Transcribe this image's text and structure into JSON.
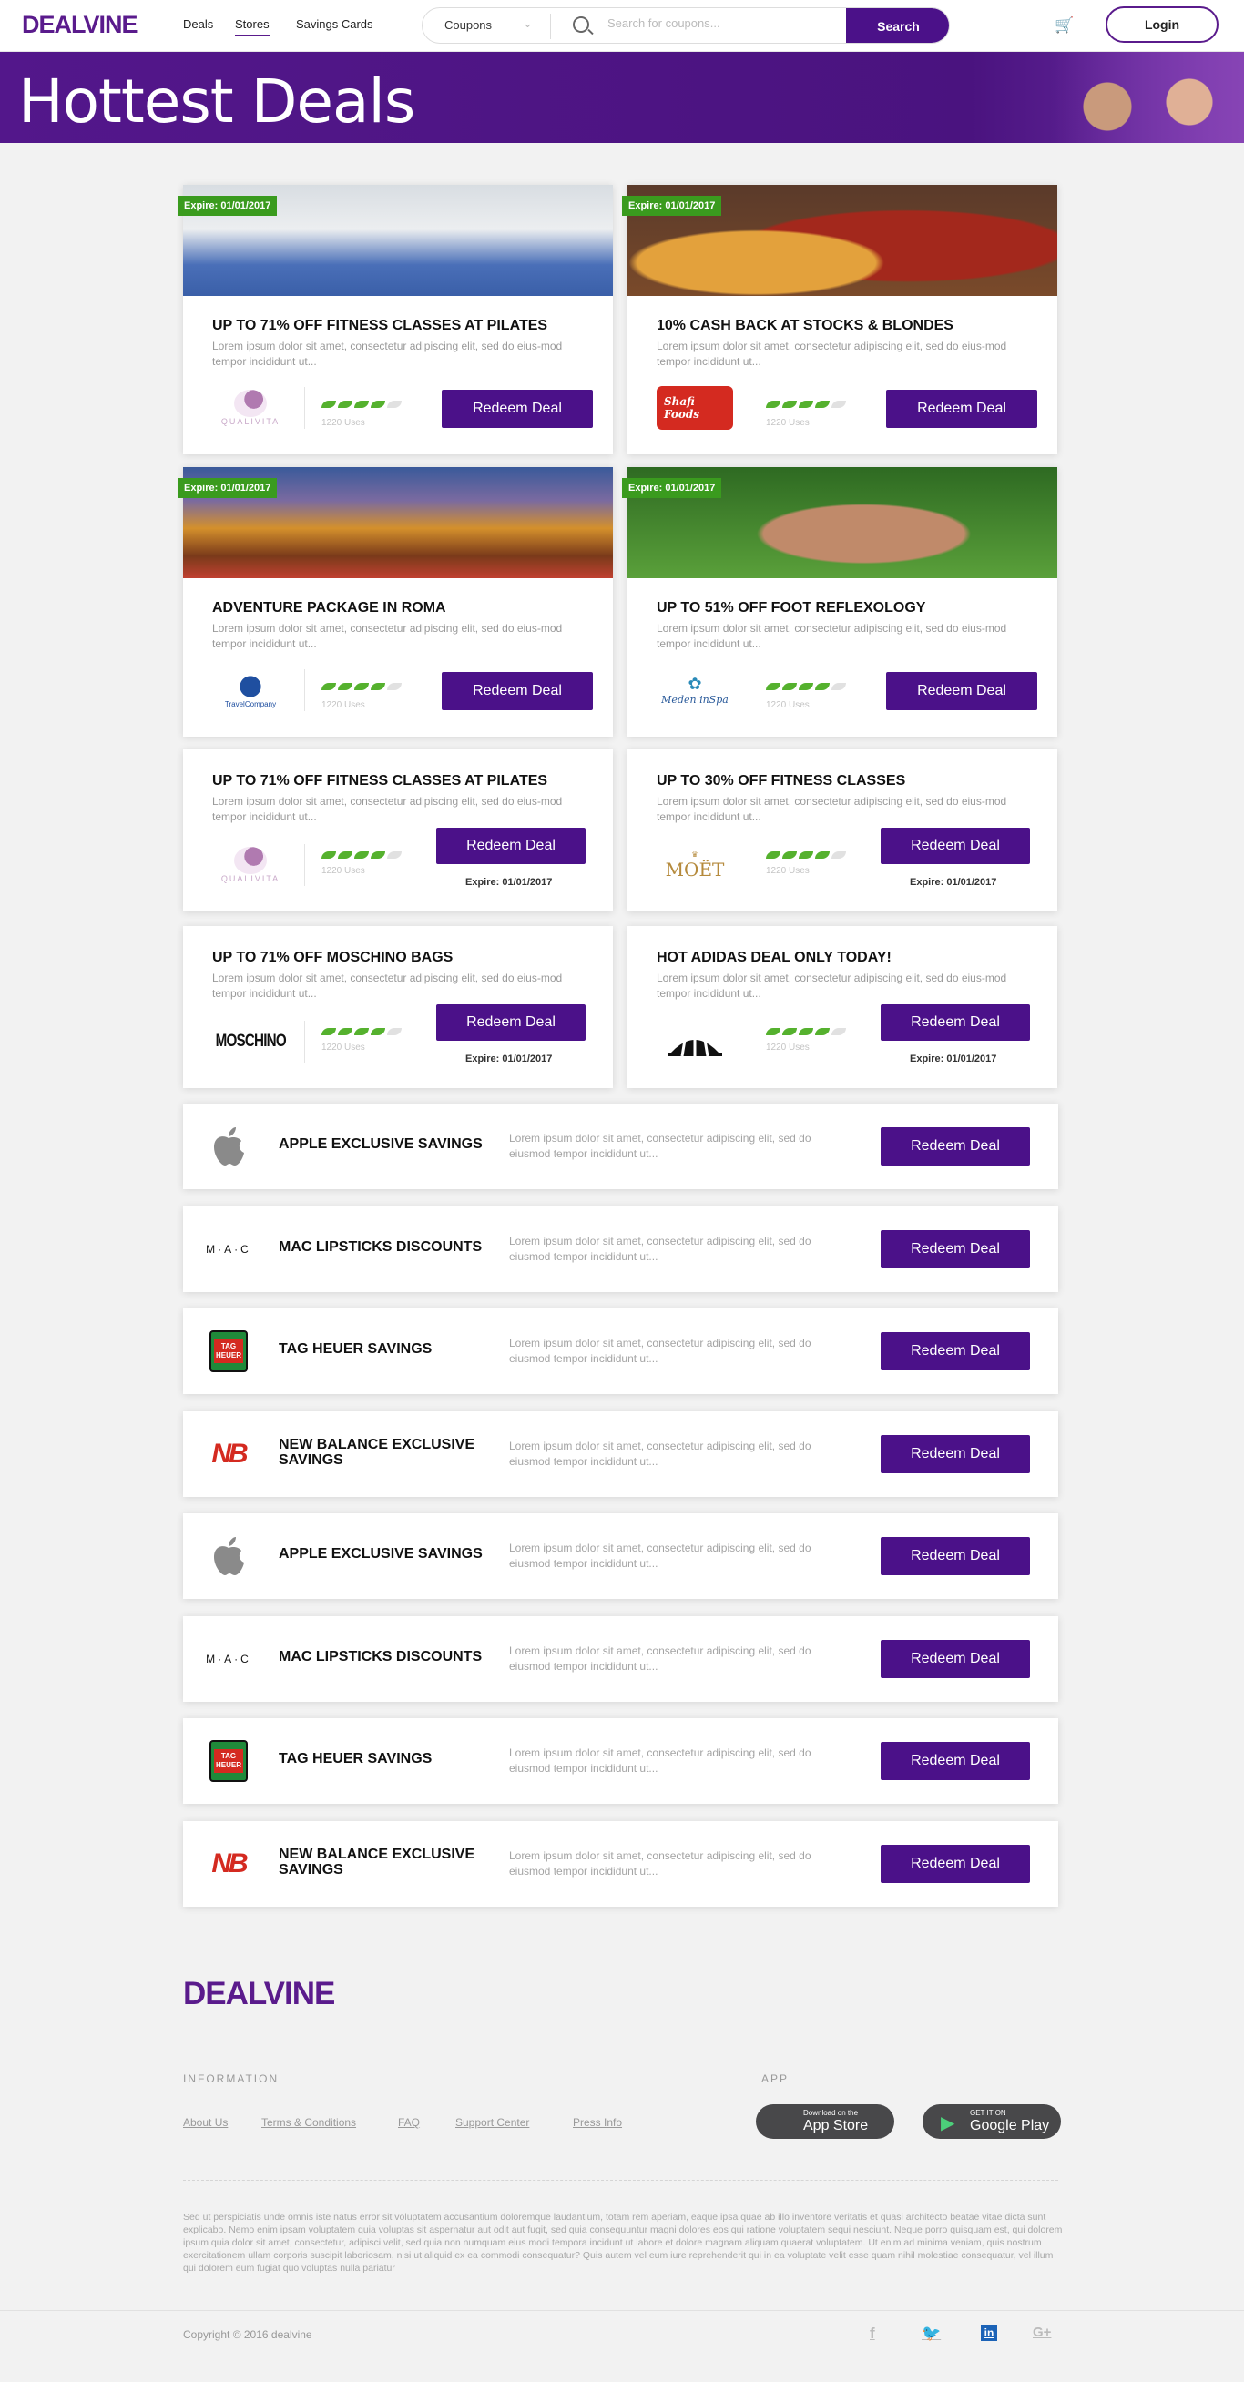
{
  "header": {
    "logo": "DEALVINE",
    "nav": [
      "Deals",
      "Stores",
      "Savings Cards"
    ],
    "active_nav": "Stores",
    "coupon_select": "Coupons",
    "search_placeholder": "Search for coupons...",
    "search_button": "Search",
    "login_button": "Login"
  },
  "banner": {
    "title": "Hottest Deals"
  },
  "image_deals": [
    {
      "expire": "Expire: 01/01/2017",
      "title": "UP TO 71% OFF FITNESS CLASSES AT PILATES",
      "desc": "Lorem ipsum dolor sit amet, consectetur adipiscing elit, sed do eius-mod tempor incididunt ut...",
      "logo": "QUALIVITA",
      "logo_icon": "qualivita-logo",
      "rating": 4,
      "uses": "1220 Uses",
      "button": "Redeem Deal"
    },
    {
      "expire": "Expire: 01/01/2017",
      "title": "10% CASH BACK AT STOCKS & BLONDES",
      "desc": "Lorem ipsum dolor sit amet, consectetur adipiscing elit, sed do eius-mod tempor incididunt ut...",
      "logo": "Shafi Foods",
      "logo_icon": "shafi-foods-logo",
      "rating": 4,
      "uses": "1220 Uses",
      "button": "Redeem Deal"
    },
    {
      "expire": "Expire: 01/01/2017",
      "title": "ADVENTURE PACKAGE IN ROMA",
      "desc": "Lorem ipsum dolor sit amet, consectetur adipiscing elit, sed do eius-mod tempor incididunt ut...",
      "logo": "TravelCompany",
      "logo_icon": "travel-company-logo",
      "rating": 4,
      "uses": "1220 Uses",
      "button": "Redeem Deal"
    },
    {
      "expire": "Expire: 01/01/2017",
      "title": "UP TO 51% OFF FOOT REFLEXOLOGY",
      "desc": "Lorem ipsum dolor sit amet, consectetur adipiscing elit, sed do eius-mod tempor incididunt ut...",
      "logo": "Meden inSpa",
      "logo_icon": "meden-inspa-logo",
      "rating": 4,
      "uses": "1220 Uses",
      "button": "Redeem Deal"
    }
  ],
  "text_deals": [
    {
      "title": "UP TO 71% OFF FITNESS CLASSES AT PILATES",
      "desc": "Lorem ipsum dolor sit amet, consectetur adipiscing elit, sed do eius-mod tempor incididunt ut...",
      "logo": "QUALIVITA",
      "logo_icon": "qualivita-logo",
      "rating": 4,
      "uses": "1220 Uses",
      "button": "Redeem Deal",
      "expire": "Expire: 01/01/2017"
    },
    {
      "title": "UP TO 30% OFF FITNESS CLASSES",
      "desc": "Lorem ipsum dolor sit amet, consectetur adipiscing elit, sed do eius-mod tempor incididunt ut...",
      "logo": "MOËT",
      "logo_icon": "moet-logo",
      "rating": 4,
      "uses": "1220 Uses",
      "button": "Redeem Deal",
      "expire": "Expire: 01/01/2017"
    },
    {
      "title": "UP TO 71% OFF MOSCHINO BAGS",
      "desc": "Lorem ipsum dolor sit amet, consectetur adipiscing elit, sed do eius-mod tempor incididunt ut...",
      "logo": "MOSCHINO",
      "logo_icon": "moschino-logo",
      "rating": 4,
      "uses": "1220 Uses",
      "button": "Redeem Deal",
      "expire": "Expire: 01/01/2017"
    },
    {
      "title": "HOT ADIDAS DEAL ONLY TODAY!",
      "desc": "Lorem ipsum dolor sit amet, consectetur adipiscing elit, sed do eius-mod tempor incididunt ut...",
      "logo": "",
      "logo_icon": "adidas-logo",
      "rating": 4,
      "uses": "1220 Uses",
      "button": "Redeem Deal",
      "expire": "Expire: 01/01/2017"
    }
  ],
  "list_deals": [
    {
      "title": "APPLE EXCLUSIVE SAVINGS",
      "logo": "",
      "logo_icon": "apple-logo",
      "desc": "Lorem ipsum dolor sit amet, consectetur adipiscing elit, sed do eiusmod tempor incididunt ut...",
      "button": "Redeem Deal"
    },
    {
      "title": "MAC LIPSTICKS DISCOUNTS",
      "logo": "M·A·C",
      "logo_icon": "mac-logo",
      "desc": "Lorem ipsum dolor sit amet, consectetur adipiscing elit, sed do eiusmod tempor incididunt ut...",
      "button": "Redeem Deal"
    },
    {
      "title": "TAG HEUER SAVINGS",
      "logo": "TAG HEUER",
      "logo_icon": "tag-heuer-logo",
      "desc": "Lorem ipsum dolor sit amet, consectetur adipiscing elit, sed do eiusmod tempor incididunt ut...",
      "button": "Redeem Deal"
    },
    {
      "title": "NEW BALANCE EXCLUSIVE SAVINGS",
      "logo": "NB",
      "logo_icon": "new-balance-logo",
      "desc": "Lorem ipsum dolor sit amet, consectetur adipiscing elit, sed do eiusmod tempor incididunt ut...",
      "button": "Redeem Deal"
    },
    {
      "title": "APPLE EXCLUSIVE SAVINGS",
      "logo": "",
      "logo_icon": "apple-logo",
      "desc": "Lorem ipsum dolor sit amet, consectetur adipiscing elit, sed do eiusmod tempor incididunt ut...",
      "button": "Redeem Deal"
    },
    {
      "title": "MAC LIPSTICKS DISCOUNTS",
      "logo": "M·A·C",
      "logo_icon": "mac-logo",
      "desc": "Lorem ipsum dolor sit amet, consectetur adipiscing elit, sed do eiusmod tempor incididunt ut...",
      "button": "Redeem Deal"
    },
    {
      "title": "TAG HEUER SAVINGS",
      "logo": "TAG HEUER",
      "logo_icon": "tag-heuer-logo",
      "desc": "Lorem ipsum dolor sit amet, consectetur adipiscing elit, sed do eiusmod tempor incididunt ut...",
      "button": "Redeem Deal"
    },
    {
      "title": "NEW BALANCE EXCLUSIVE SAVINGS",
      "logo": "NB",
      "logo_icon": "new-balance-logo",
      "desc": "Lorem ipsum dolor sit amet, consectetur adipiscing elit, sed do eiusmod tempor incididunt ut...",
      "button": "Redeem Deal"
    }
  ],
  "footer": {
    "logo": "DEALVINE",
    "info_heading": "INFORMATION",
    "app_heading": "APP",
    "links": [
      "About Us",
      "Terms & Conditions",
      "FAQ",
      "Support Center",
      "Press Info"
    ],
    "app_store_small": "Download on the",
    "app_store_big": "App Store",
    "google_play_small": "GET IT ON",
    "google_play_big": "Google Play",
    "legal": "Sed ut perspiciatis unde omnis iste natus error sit voluptatem accusantium doloremque laudantium, totam rem aperiam, eaque ipsa quae ab illo inventore veritatis et quasi architecto beatae vitae dicta sunt explicabo. Nemo enim ipsam voluptatem quia voluptas sit aspernatur aut odit aut fugit, sed quia consequuntur magni dolores eos qui ratione voluptatem sequi nesciunt. Neque porro quisquam est, qui dolorem ipsum quia dolor sit amet, consectetur, adipisci velit, sed quia non numquam eius modi tempora incidunt ut labore et dolore magnam aliquam quaerat voluptatem. Ut enim ad minima veniam, quis nostrum exercitationem ullam corporis suscipit laboriosam, nisi ut aliquid ex ea commodi consequatur? Quis autem vel eum iure reprehenderit qui in ea voluptate velit esse quam nihil molestiae consequatur, vel illum qui dolorem eum fugiat quo voluptas nulla pariatur",
    "copyright": "Copyright © 2016 dealvine",
    "social": [
      "facebook-icon",
      "twitter-icon",
      "linkedin-icon",
      "google-plus-icon"
    ]
  },
  "colors": {
    "brand": "#4b1189",
    "accent_green": "#3a9b1e",
    "leaf_on": "#55b12e",
    "leaf_off": "#e1e1e1"
  }
}
